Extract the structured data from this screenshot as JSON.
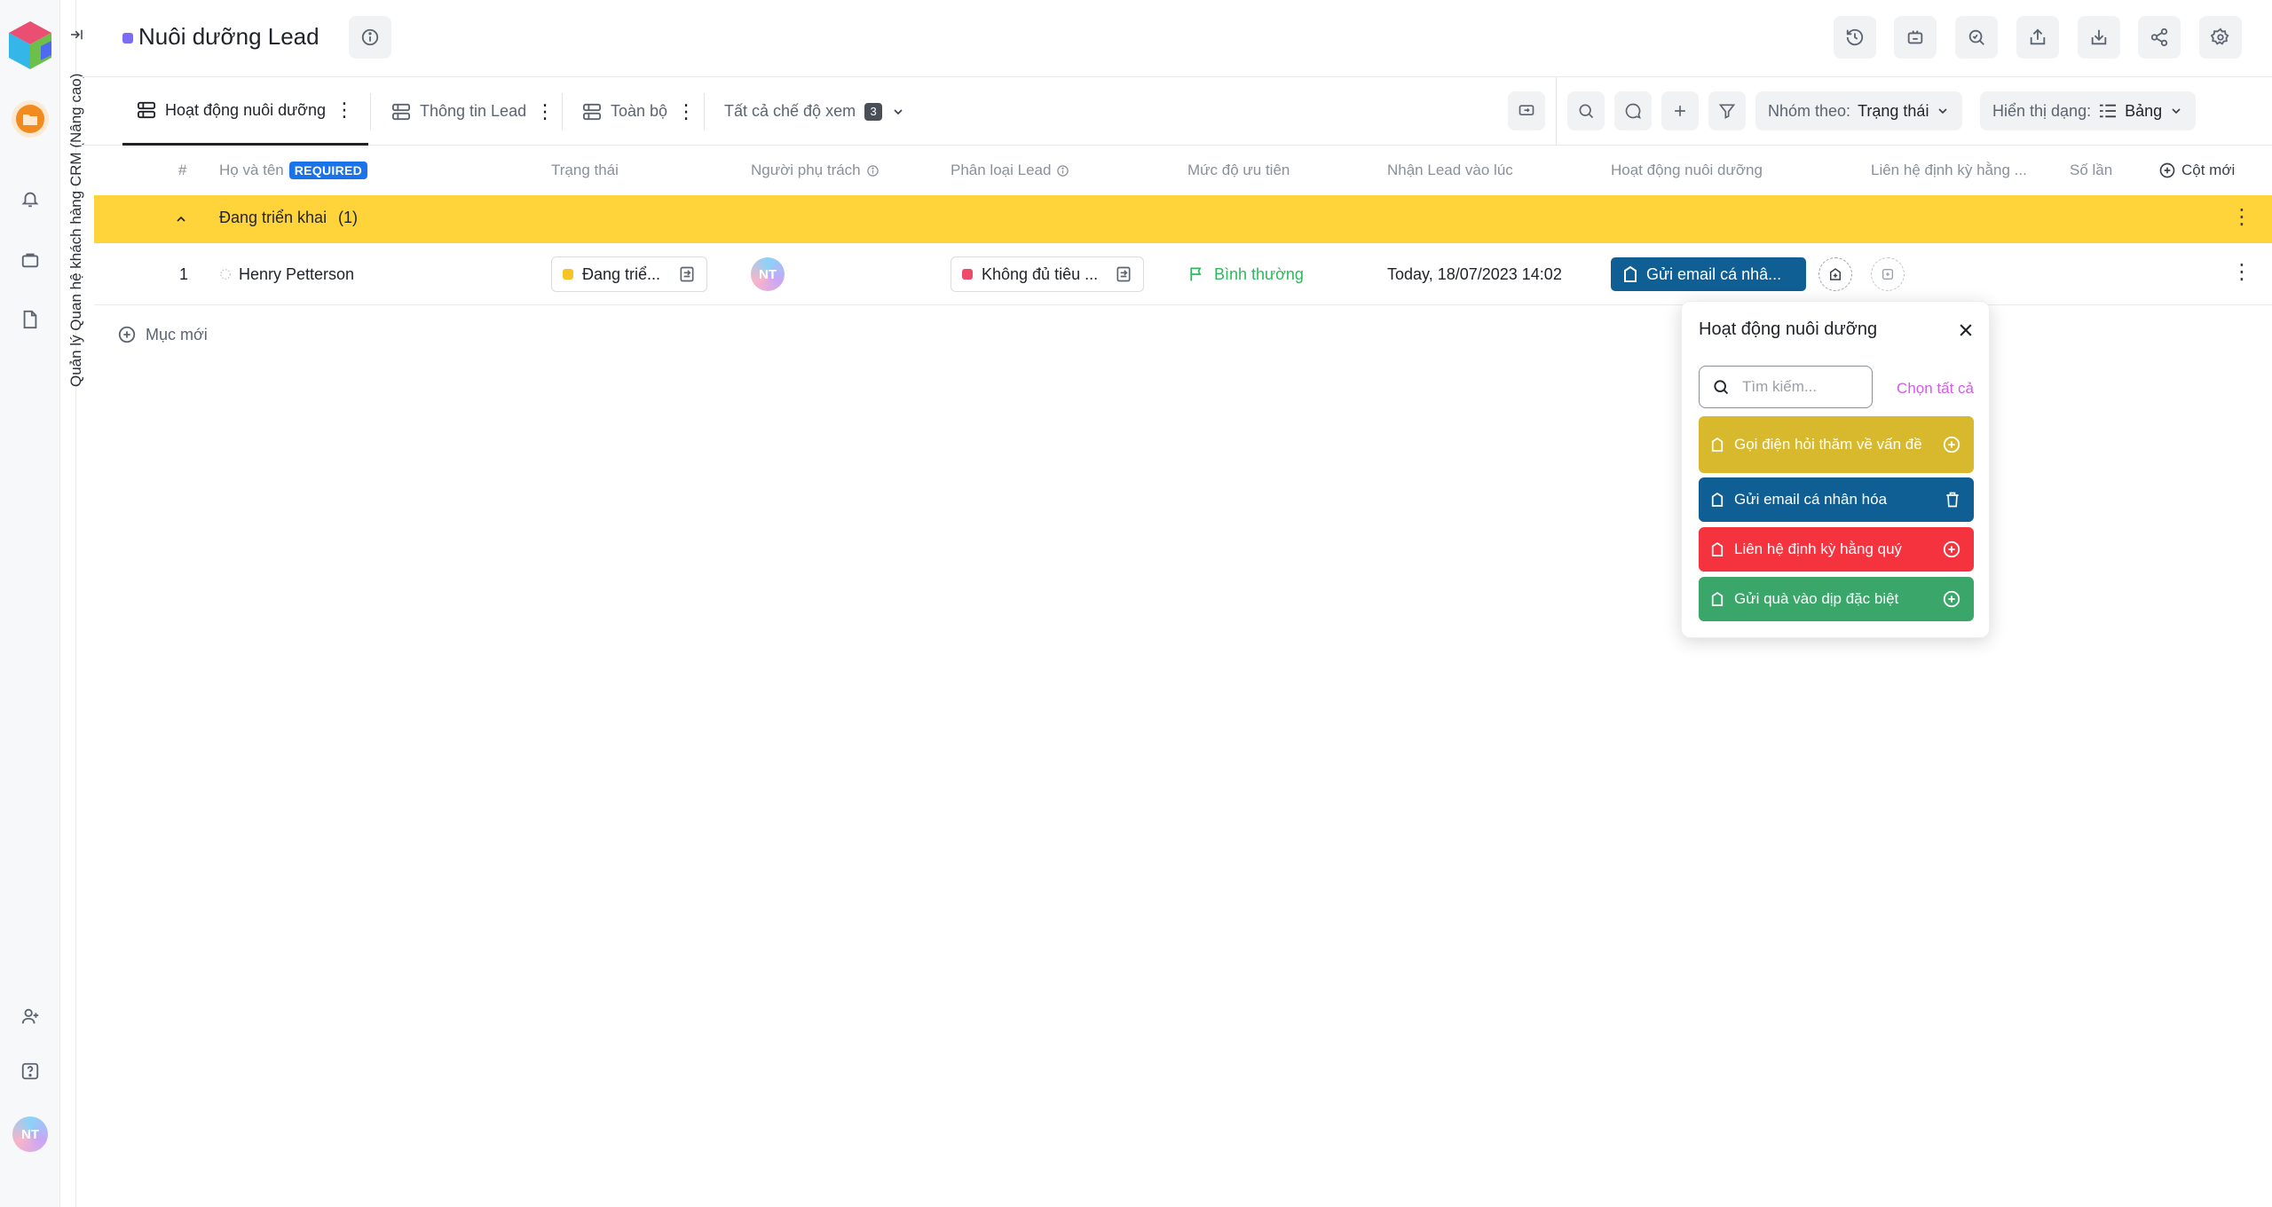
{
  "app": {
    "vertical_title": "Quản lý Quan hệ khách hàng CRM (Nâng cao)",
    "user_initials": "NT"
  },
  "header": {
    "title": "Nuôi dưỡng Lead"
  },
  "tabs": [
    {
      "label": "Hoạt động nuôi dưỡng"
    },
    {
      "label": "Thông tin Lead"
    },
    {
      "label": "Toàn bộ"
    }
  ],
  "views": {
    "label": "Tất cả chế độ xem",
    "count": "3"
  },
  "toolbar": {
    "group_by_label": "Nhóm theo:",
    "group_by_value": "Trạng thái",
    "display_label": "Hiển thị dạng:",
    "display_value": "Bảng"
  },
  "columns": {
    "num": "#",
    "name": "Họ và tên",
    "required": "REQUIRED",
    "status": "Trạng thái",
    "owner": "Người phụ trách",
    "lead_type": "Phân loại Lead",
    "priority": "Mức độ ưu tiên",
    "received": "Nhận Lead vào lúc",
    "activity": "Hoạt động nuôi dưỡng",
    "periodic": "Liên hệ định kỳ hằng ...",
    "number": "Số lần",
    "new_col": "Cột mới"
  },
  "group": {
    "label": "Đang triển khai",
    "count": "(1)"
  },
  "row": {
    "index": "1",
    "name": "Henry Petterson",
    "status": "Đang triể...",
    "owner_initials": "NT",
    "lead_type": "Không đủ tiêu ...",
    "priority": "Bình thường",
    "received": "Today, 18/07/2023 14:02",
    "activity": "Gửi email cá nhâ..."
  },
  "add_item": "Mục mới",
  "popover": {
    "title": "Hoạt động nuôi dưỡng",
    "search_placeholder": "Tìm kiếm...",
    "select_all": "Chọn tất cả",
    "options": [
      {
        "label": "Gọi điện hỏi thăm về vấn đề",
        "color": "#d8b82c",
        "action": "add"
      },
      {
        "label": "Gửi email cá nhân hóa",
        "color": "#0f5e94",
        "action": "remove"
      },
      {
        "label": "Liên hệ định kỳ hằng quý",
        "color": "#f5333f",
        "action": "add"
      },
      {
        "label": "Gửi quà vào dịp đặc biệt",
        "color": "#3aa66a",
        "action": "add"
      }
    ]
  },
  "colors": {
    "group_bg": "#ffd43b",
    "status_dot": "#f7c325",
    "lead_type_dot": "#f04a6a",
    "priority": "#2eb85c",
    "accent": "#1a73e8"
  }
}
